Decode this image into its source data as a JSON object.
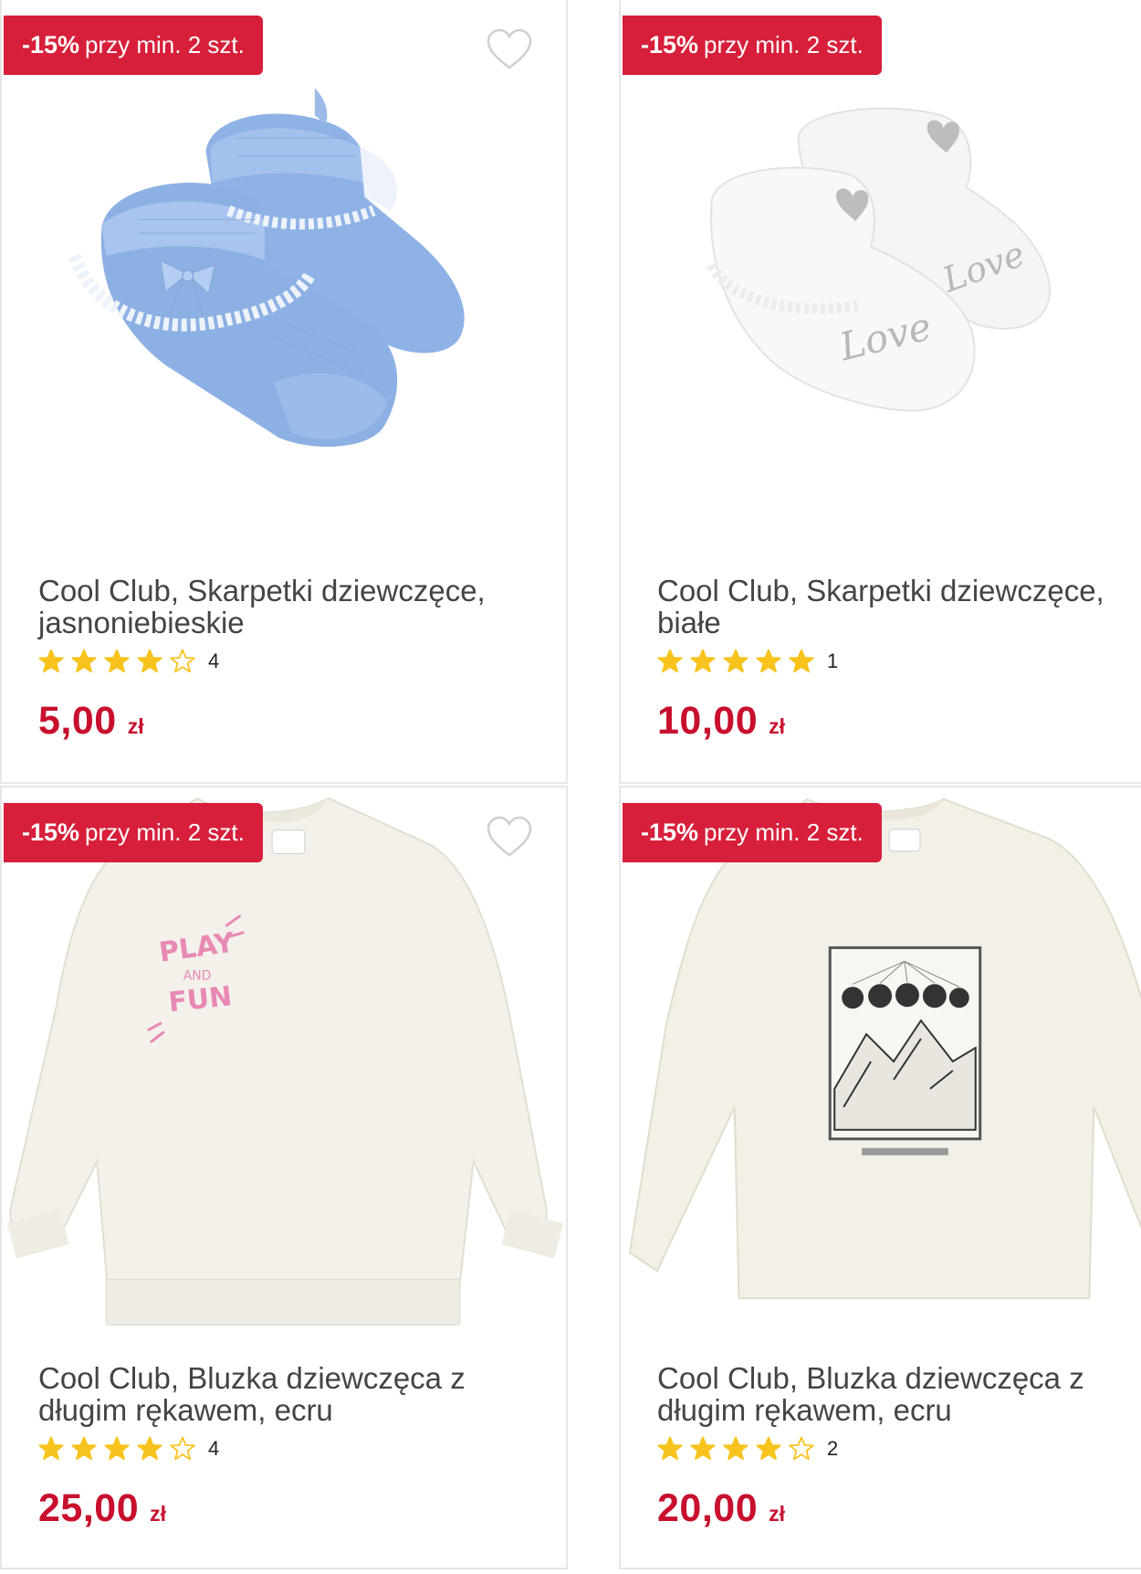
{
  "colors": {
    "accent": "#d71f3b",
    "price": "#c8102e",
    "star": "#f7c31c"
  },
  "products": [
    {
      "badge_pct": "-15%",
      "badge_text": "przy min. 2 szt.",
      "title": "Cool Club, Skarpetki dziewczęce, jasnoniebieskie",
      "rating": 4,
      "rating_count": "4",
      "price": "5,00",
      "currency": "zł",
      "image": "light-blue-baby-booties"
    },
    {
      "badge_pct": "-15%",
      "badge_text": "przy min. 2 szt.",
      "title": "Cool Club, Skarpetki dziewczęce, białe",
      "rating": 5,
      "rating_count": "1",
      "price": "10,00",
      "currency": "zł",
      "image": "white-baby-booties-love"
    },
    {
      "badge_pct": "-15%",
      "badge_text": "przy min. 2 szt.",
      "title": "Cool Club, Bluzka dziewczęca z długim rękawem, ecru",
      "rating": 4,
      "rating_count": "4",
      "price": "25,00",
      "currency": "zł",
      "image": "ecru-sweatshirt-play-and-fun"
    },
    {
      "badge_pct": "-15%",
      "badge_text": "przy min. 2 szt.",
      "title": "Cool Club, Bluzka dziewczęca z długim rękawem, ecru",
      "rating": 4,
      "rating_count": "2",
      "price": "20,00",
      "currency": "zł",
      "image": "ecru-longsleeve-moon-print"
    }
  ],
  "print_text": {
    "play": "PLAY",
    "and": "AND",
    "fun": "FUN",
    "love": "Love"
  }
}
